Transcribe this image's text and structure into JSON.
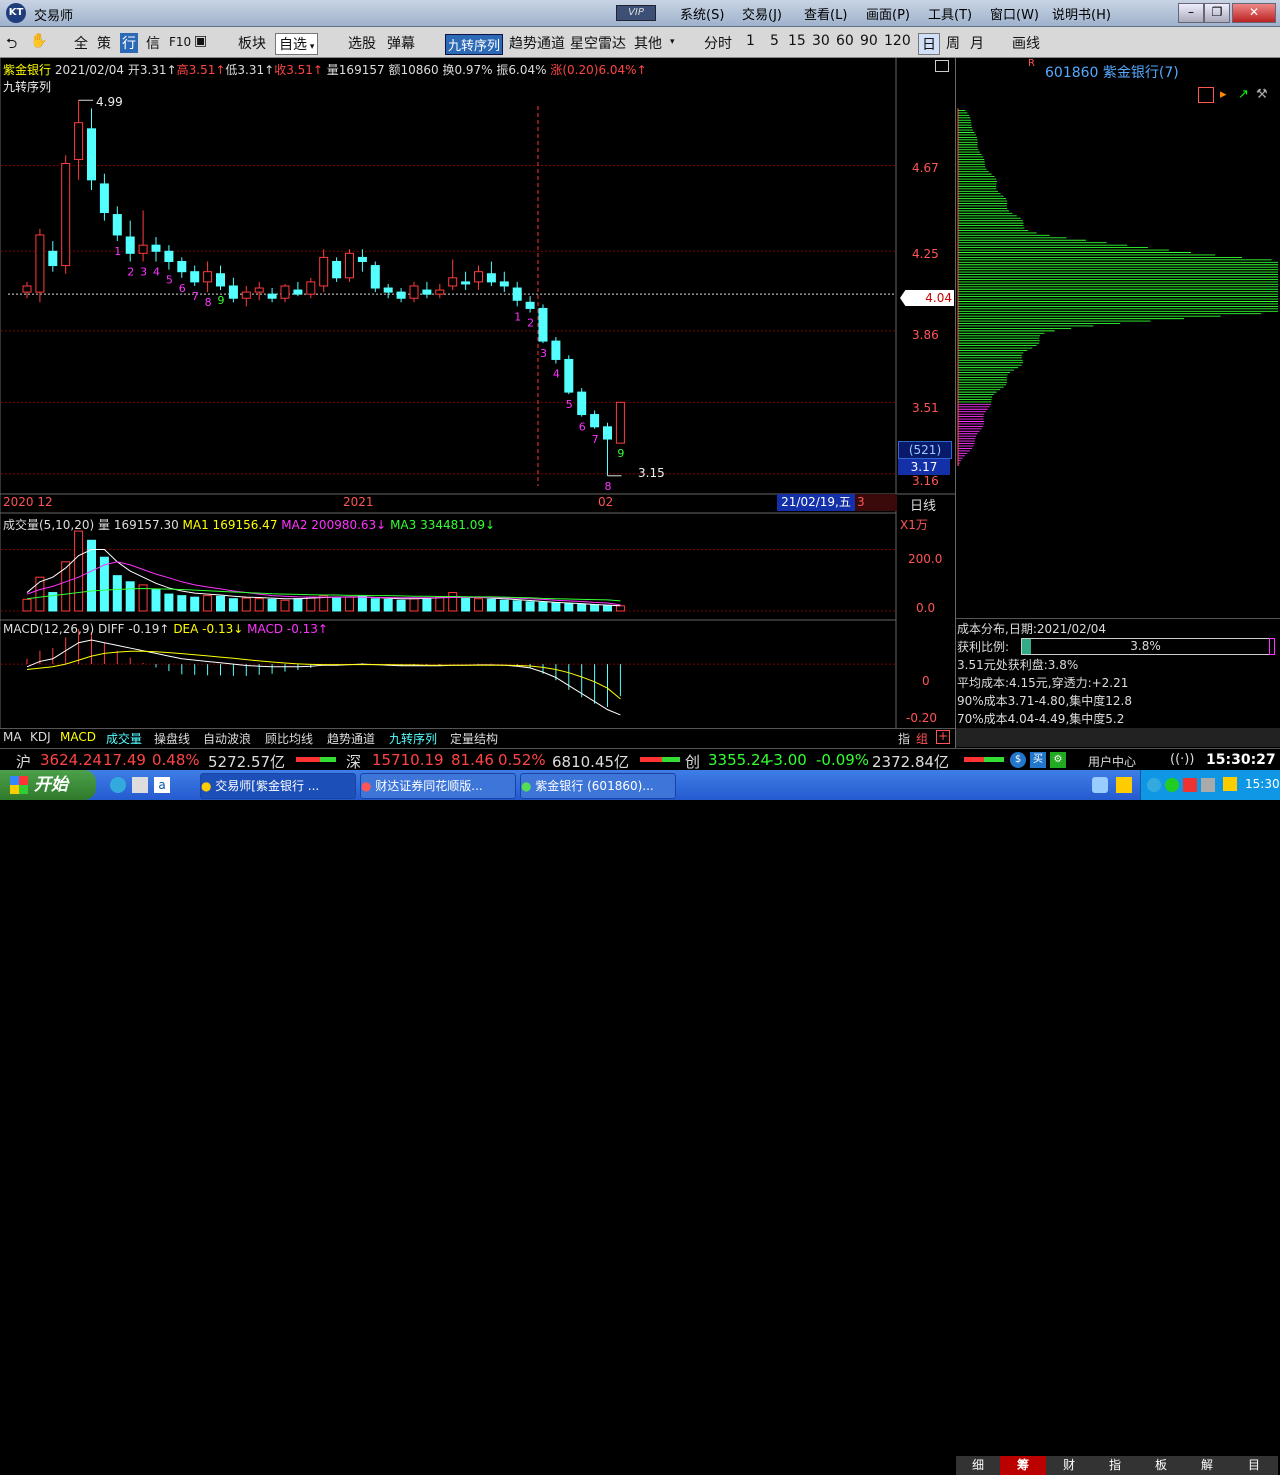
{
  "window": {
    "title": "交易师",
    "logo": "KT",
    "vip": "VIP",
    "menu": [
      "系统(S)",
      "交易(J)",
      "查看(L)",
      "画面(P)",
      "工具(T)",
      "窗口(W)",
      "说明书(H)"
    ],
    "controls": [
      "–",
      "❐",
      "✕"
    ]
  },
  "toolbar": {
    "items": [
      "全",
      "策",
      "行",
      "信",
      "F10",
      "板块",
      "自选",
      "选股",
      "弹幕",
      "九转序列",
      "趋势通道",
      "星空雷达",
      "其他",
      "分时",
      "1",
      "5",
      "15",
      "30",
      "60",
      "90",
      "120",
      "日",
      "周",
      "月",
      "画线"
    ]
  },
  "kline": {
    "info_name": "紫金银行",
    "info_date": "2021/02/04",
    "info_open": "开3.31↑",
    "info_high": "高3.51↑",
    "info_low": "低3.31↑",
    "info_close": "收3.51↑",
    "info_vol": "量169157",
    "info_amt": "额10860",
    "info_turn": "换0.97%",
    "info_amp": "振6.04%",
    "info_chg": "涨(0.20)6.04%↑",
    "indicator_name": "九转序列",
    "high_mark": "4.99",
    "low_mark": "3.15",
    "price_axis": [
      "4.67",
      "4.25",
      "3.86",
      "3.51",
      "3.16"
    ],
    "current_price": "4.04",
    "cursor_count": "(521)",
    "cursor_price": "3.17",
    "date_axis": [
      "2020 12",
      "2021",
      "02"
    ],
    "cursor_date": "21/02/19,五",
    "cursor_num": "3",
    "period": "日线",
    "td_labels": [
      "1",
      "2",
      "3",
      "4",
      "5",
      "6",
      "7",
      "8",
      "9",
      "1",
      "2",
      "3",
      "4",
      "5",
      "6",
      "7",
      "8",
      "9"
    ]
  },
  "volume": {
    "title": "成交量(5,10,20)",
    "vol": "量 169157.30",
    "ma1": "MA1 169156.47",
    "ma2": "MA2 200980.63↓",
    "ma3": "MA3 334481.09↓",
    "unit": "X1万",
    "axis": [
      "200.0",
      "0.0"
    ]
  },
  "macd": {
    "title": "MACD(12,26,9)",
    "diff": "DIFF -0.19↑",
    "dea": "DEA -0.13↓",
    "macd": "MACD -0.13↑",
    "axis": [
      "0",
      "-0.20"
    ]
  },
  "indicator_tabs": [
    "MA",
    "KDJ",
    "MACD",
    "成交量",
    "操盘线",
    "自动波浪",
    "顾比均线",
    "趋势通道",
    "九转序列",
    "定量结构"
  ],
  "right_tabs_small": [
    "指",
    "组"
  ],
  "side": {
    "rmark": "R",
    "code": "601860",
    "name": "紫金银行(7)",
    "cost_title": "成本分布,日期:2021/02/04",
    "profit_label": "获利比例:",
    "profit_value": "3.8%",
    "profit_ratio": 0.038,
    "lines": [
      "3.51元处获利盘:3.8%",
      "平均成本:4.15元,穿透力:+2.21",
      "90%成本3.71-4.80,集中度12.8",
      "70%成本4.04-4.49,集中度5.2"
    ],
    "tabs": [
      "细",
      "筹",
      "财",
      "指",
      "板",
      "解",
      "目"
    ]
  },
  "status": {
    "sh_label": "沪",
    "sh_index": "3624.24",
    "sh_chg": "17.49",
    "sh_pct": "0.48%",
    "sh_amt": "5272.57亿",
    "sz_label": "深",
    "sz_index": "15710.19",
    "sz_chg": "81.46",
    "sz_pct": "0.52%",
    "sz_amt": "6810.45亿",
    "cy_label": "创",
    "cy_index": "3355.24",
    "cy_chg": "-3.00",
    "cy_pct": "-0.09%",
    "cy_amt": "2372.84亿",
    "user_center": "用户中心",
    "time": "15:30:27"
  },
  "taskbar": {
    "start": "开始",
    "tasks": [
      "交易师[紫金银行 ...",
      "财达证券同花顺版...",
      "紫金银行 (601860)..."
    ],
    "clock": "15:30"
  },
  "colors": {
    "up": "#ff3c3c",
    "down": "#54ffff",
    "ma1": "#ffffff",
    "ma2": "#ff33ff",
    "ma3": "#33ff33",
    "grid": "#7a0000"
  },
  "chart_data": {
    "type": "candlestick",
    "ylim": [
      3.1,
      5.05
    ],
    "candles": [
      [
        4.05,
        4.1,
        4.02,
        4.08
      ],
      [
        4.05,
        4.36,
        4.0,
        4.33
      ],
      [
        4.25,
        4.3,
        4.15,
        4.18
      ],
      [
        4.18,
        4.72,
        4.14,
        4.68
      ],
      [
        4.7,
        4.99,
        4.6,
        4.88
      ],
      [
        4.85,
        4.95,
        4.55,
        4.6
      ],
      [
        4.58,
        4.63,
        4.4,
        4.44
      ],
      [
        4.43,
        4.47,
        4.3,
        4.33
      ],
      [
        4.32,
        4.4,
        4.2,
        4.24
      ],
      [
        4.24,
        4.45,
        4.2,
        4.28
      ],
      [
        4.28,
        4.32,
        4.2,
        4.25
      ],
      [
        4.25,
        4.28,
        4.16,
        4.2
      ],
      [
        4.2,
        4.22,
        4.12,
        4.15
      ],
      [
        4.15,
        4.18,
        4.08,
        4.1
      ],
      [
        4.1,
        4.2,
        4.05,
        4.15
      ],
      [
        4.14,
        4.18,
        4.06,
        4.08
      ],
      [
        4.08,
        4.12,
        4.0,
        4.02
      ],
      [
        4.02,
        4.08,
        3.98,
        4.05
      ],
      [
        4.05,
        4.1,
        4.01,
        4.07
      ],
      [
        4.04,
        4.07,
        4.0,
        4.02
      ],
      [
        4.02,
        4.09,
        4.0,
        4.08
      ],
      [
        4.06,
        4.1,
        4.03,
        4.04
      ],
      [
        4.04,
        4.12,
        4.02,
        4.1
      ],
      [
        4.08,
        4.26,
        4.05,
        4.22
      ],
      [
        4.2,
        4.22,
        4.1,
        4.12
      ],
      [
        4.12,
        4.26,
        4.1,
        4.24
      ],
      [
        4.22,
        4.26,
        4.15,
        4.2
      ],
      [
        4.18,
        4.2,
        4.05,
        4.07
      ],
      [
        4.07,
        4.09,
        4.02,
        4.05
      ],
      [
        4.05,
        4.07,
        4.0,
        4.02
      ],
      [
        4.02,
        4.1,
        4.0,
        4.08
      ],
      [
        4.06,
        4.1,
        4.02,
        4.04
      ],
      [
        4.04,
        4.09,
        4.02,
        4.06
      ],
      [
        4.08,
        4.21,
        4.06,
        4.12
      ],
      [
        4.1,
        4.15,
        4.06,
        4.09
      ],
      [
        4.1,
        4.18,
        4.06,
        4.15
      ],
      [
        4.14,
        4.2,
        4.08,
        4.1
      ],
      [
        4.1,
        4.15,
        4.05,
        4.08
      ],
      [
        4.07,
        4.1,
        3.98,
        4.01
      ],
      [
        4.0,
        4.03,
        3.95,
        3.97
      ],
      [
        3.97,
        3.99,
        3.8,
        3.81
      ],
      [
        3.81,
        3.83,
        3.7,
        3.72
      ],
      [
        3.72,
        3.74,
        3.55,
        3.56
      ],
      [
        3.56,
        3.58,
        3.44,
        3.45
      ],
      [
        3.45,
        3.47,
        3.38,
        3.39
      ],
      [
        3.39,
        3.41,
        3.15,
        3.33
      ],
      [
        3.31,
        3.51,
        3.31,
        3.51
      ]
    ],
    "volumes": [
      38,
      110,
      60,
      160,
      260,
      230,
      175,
      115,
      95,
      85,
      70,
      55,
      50,
      45,
      50,
      48,
      40,
      42,
      40,
      38,
      35,
      40,
      45,
      50,
      42,
      45,
      48,
      40,
      38,
      35,
      40,
      42,
      45,
      60,
      45,
      40,
      38,
      35,
      33,
      30,
      28,
      26,
      24,
      22,
      20,
      18,
      17
    ],
    "ma1": [
      60,
      95,
      110,
      140,
      180,
      200,
      200,
      160,
      130,
      110,
      90,
      75,
      65,
      58,
      55,
      52,
      48,
      45,
      44,
      42,
      40,
      40,
      42,
      44,
      45,
      46,
      46,
      44,
      42,
      40,
      40,
      41,
      43,
      46,
      46,
      45,
      42,
      40,
      37,
      34,
      31,
      28,
      26,
      24,
      21,
      19,
      17
    ],
    "ma2": [
      55,
      70,
      80,
      95,
      110,
      130,
      150,
      160,
      150,
      135,
      120,
      108,
      95,
      85,
      78,
      72,
      65,
      60,
      55,
      50,
      48,
      46,
      45,
      45,
      45,
      45,
      45,
      44,
      44,
      43,
      43,
      43,
      43,
      44,
      44,
      44,
      44,
      43,
      42,
      40,
      38,
      35,
      33,
      31,
      28,
      26,
      20
    ],
    "ma3": [
      40,
      45,
      50,
      55,
      60,
      65,
      68,
      70,
      72,
      73,
      72,
      71,
      70,
      68,
      66,
      64,
      62,
      60,
      58,
      56,
      55,
      54,
      53,
      52,
      52,
      51,
      51,
      50,
      50,
      49,
      48,
      48,
      47,
      47,
      46,
      46,
      46,
      45,
      44,
      43,
      41,
      40,
      39,
      38,
      37,
      36,
      33
    ],
    "macd_ylim": [
      -0.22,
      0.12
    ],
    "diff": [
      -0.01,
      0.01,
      0.02,
      0.05,
      0.08,
      0.09,
      0.08,
      0.07,
      0.06,
      0.05,
      0.04,
      0.03,
      0.02,
      0.015,
      0.01,
      0.005,
      0.0,
      -0.005,
      -0.008,
      -0.01,
      -0.01,
      -0.01,
      -0.008,
      -0.004,
      -0.004,
      -0.002,
      0.0,
      -0.002,
      -0.004,
      -0.006,
      -0.006,
      -0.006,
      -0.006,
      -0.004,
      -0.004,
      -0.003,
      -0.003,
      -0.004,
      -0.008,
      -0.014,
      -0.03,
      -0.05,
      -0.08,
      -0.11,
      -0.14,
      -0.17,
      -0.19
    ],
    "dea": [
      -0.02,
      -0.015,
      -0.01,
      0.0,
      0.015,
      0.03,
      0.04,
      0.045,
      0.048,
      0.048,
      0.046,
      0.043,
      0.039,
      0.035,
      0.031,
      0.026,
      0.022,
      0.017,
      0.012,
      0.008,
      0.004,
      0.001,
      -0.001,
      -0.002,
      -0.002,
      -0.002,
      -0.002,
      -0.002,
      -0.002,
      -0.003,
      -0.003,
      -0.004,
      -0.004,
      -0.004,
      -0.004,
      -0.004,
      -0.004,
      -0.004,
      -0.005,
      -0.007,
      -0.012,
      -0.02,
      -0.032,
      -0.048,
      -0.066,
      -0.09,
      -0.13
    ],
    "price_profile": [
      [
        3.3,
        0.05
      ],
      [
        3.4,
        0.08
      ],
      [
        3.5,
        0.1
      ],
      [
        3.6,
        0.15
      ],
      [
        3.7,
        0.2
      ],
      [
        3.8,
        0.25
      ],
      [
        3.9,
        0.3
      ],
      [
        3.95,
        0.45
      ],
      [
        4.0,
        0.85
      ],
      [
        4.04,
        0.9
      ],
      [
        4.08,
        1.0
      ],
      [
        4.12,
        0.7
      ],
      [
        4.16,
        0.6
      ],
      [
        4.2,
        0.45
      ],
      [
        4.25,
        0.35
      ],
      [
        4.3,
        0.25
      ],
      [
        4.4,
        0.2
      ],
      [
        4.5,
        0.15
      ],
      [
        4.6,
        0.12
      ],
      [
        4.7,
        0.08
      ],
      [
        4.8,
        0.06
      ],
      [
        4.9,
        0.04
      ]
    ]
  }
}
